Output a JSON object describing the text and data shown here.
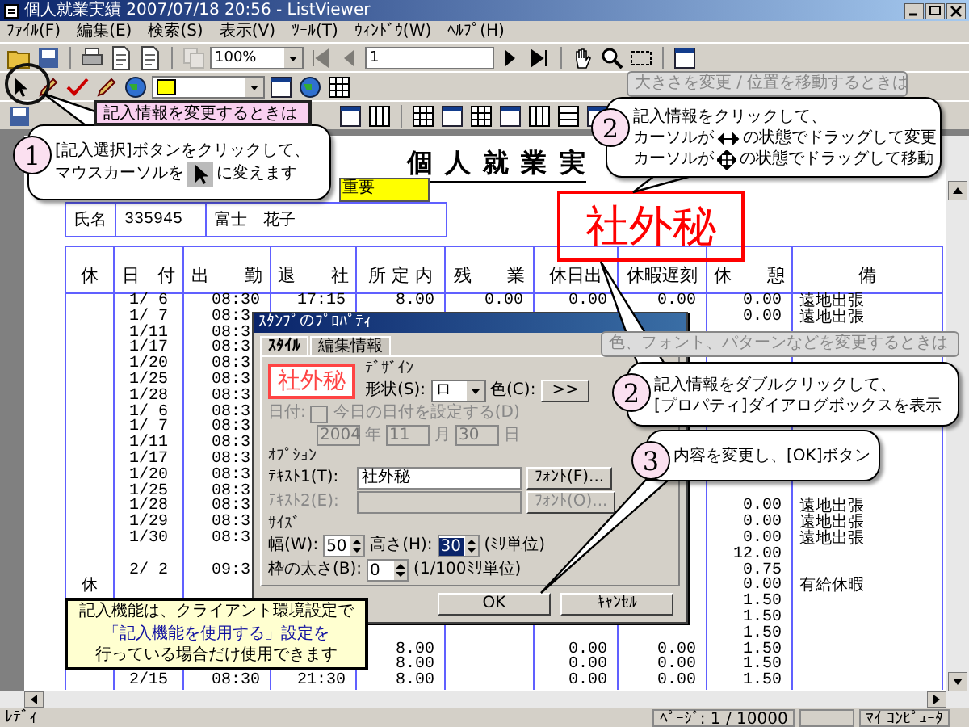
{
  "window": {
    "title": "個人就業実績 2007/07/18 20:56 - ListViewer"
  },
  "menu": [
    "ﾌｧｲﾙ(F)",
    "編集(E)",
    "検索(S)",
    "表示(V)",
    "ﾂｰﾙ(T)",
    "ｳｨﾝﾄﾞｳ(W)",
    "ﾍﾙﾌﾟ(H)"
  ],
  "toolbar": {
    "zoom": "100%",
    "page": "1"
  },
  "document": {
    "title": "個 人 就 業 実",
    "name_row": [
      "氏名",
      "335945",
      "富士　花子"
    ],
    "sticky_note": "重要",
    "stamp": "社外秘",
    "columns": [
      "休",
      "日　付",
      "出　　勤",
      "退　　社",
      "所 定 内",
      "残　　業",
      "休日出",
      "休暇遅刻",
      "休　　憩",
      "備"
    ],
    "rows": [
      {
        "date": "1/ 6",
        "start": "08:30",
        "end": "17:15",
        "scheduled": "8.00",
        "overtime": "0.00",
        "holiday_work": "0.00",
        "leave_late": "0.00",
        "break": "0.00",
        "note": "遠地出張"
      },
      {
        "date": "1/ 7",
        "start": "08:3",
        "break": "0.00",
        "note": "遠地出張"
      },
      {
        "date": "1/11",
        "start": "08:3"
      },
      {
        "date": "1/17",
        "start": "08:3"
      },
      {
        "date": "1/20",
        "start": "08:3"
      },
      {
        "date": "1/25",
        "start": "08:3"
      },
      {
        "date": "1/28",
        "start": "08:3"
      },
      {
        "date": "1/ 6",
        "start": "08:3"
      },
      {
        "date": "1/ 7",
        "start": "08:3"
      },
      {
        "date": "1/11",
        "start": "08:3"
      },
      {
        "date": "1/17",
        "start": "08:3"
      },
      {
        "date": "1/20",
        "start": "08:3"
      },
      {
        "date": "1/25",
        "start": "08:3"
      },
      {
        "date": "1/28",
        "start": "08:3",
        "break": "0.00",
        "note": "遠地出張"
      },
      {
        "date": "1/29",
        "start": "08:3",
        "break": "0.00",
        "note": "遠地出張"
      },
      {
        "date": "1/30",
        "start": "08:3",
        "break": "0.00",
        "note": "遠地出張"
      },
      {
        "break": "12.00"
      },
      {
        "date": "2/ 2",
        "start": "09:3",
        "break": "0.75"
      },
      {
        "off": "休",
        "break": "0.00",
        "note": "有給休暇"
      },
      {
        "break": "1.50"
      },
      {
        "break": "1.50"
      },
      {
        "break": "1.50"
      },
      {
        "scheduled": "8.00",
        "holiday_work": "0.00",
        "leave_late": "0.00",
        "break": "1.50"
      },
      {
        "scheduled": "8.00",
        "holiday_work": "0.00",
        "leave_late": "0.00",
        "break": "1.50"
      },
      {
        "date": "2/15",
        "start": "08:30",
        "end": "21:30",
        "scheduled": "8.00",
        "holiday_work": "0.00",
        "leave_late": "0.00",
        "break": "1.50"
      }
    ]
  },
  "dialog": {
    "title": "ｽﾀﾝﾌﾟのﾌﾟﾛﾊﾟﾃｨ",
    "tabs": [
      {
        "label": "ｽﾀｲﾙ",
        "selected": true
      },
      {
        "label": "編集情報",
        "selected": false
      }
    ],
    "preview": "社外秘",
    "design_label": "ﾃﾞｻﾞｲﾝ",
    "shape_label": "形状(S):",
    "shape_value": "ロ",
    "color_label": "色(C):",
    "color_button": ">>",
    "date_label": "日付:",
    "date_checkbox": {
      "label": "今日の日付を設定する(D)",
      "checked": false,
      "disabled": true
    },
    "date_fields": [
      {
        "value": "2004",
        "unit": "年"
      },
      {
        "value": "11",
        "unit": "月"
      },
      {
        "value": "30",
        "unit": "日"
      }
    ],
    "options_label": "ｵﾌﾟｼｮﾝ",
    "text_fields": [
      {
        "label": "ﾃｷｽﾄ1(T):",
        "value": "社外秘",
        "button": "ﾌｫﾝﾄ(F)...",
        "disabled": false
      },
      {
        "label": "ﾃｷｽﾄ2(E):",
        "button": "ﾌｫﾝﾄ(O)...",
        "disabled": true
      }
    ],
    "size_label": "ｻｲｽﾞ",
    "size_fields": [
      {
        "label": "幅(W):",
        "value": "50",
        "selected": false
      },
      {
        "label": "高さ(H):",
        "value": "30",
        "selected": true
      },
      {
        "label": "枠の太さ(B):",
        "value": "0",
        "selected": false
      }
    ],
    "size_units": [
      "(ﾐﾘ単位)",
      "(1/100ﾐﾘ単位)"
    ],
    "buttons": [
      "OK",
      "ｷｬﾝｾﾙ"
    ]
  },
  "callouts": [
    {
      "label": "記入情報を変更するときは",
      "number": "1",
      "lines": [
        {
          "parts": [
            "[記入選択]ボタンをクリックして、"
          ]
        },
        {
          "parts": [
            "マウスカーソルを",
            "に変えます"
          ]
        }
      ]
    },
    {
      "label": "大きさを変更 / 位置を移動するときは",
      "number": "2",
      "lines": [
        {
          "parts": [
            "記入情報をクリックして、"
          ]
        },
        {
          "parts": [
            "カーソルが",
            "の状態でドラッグして変更"
          ]
        },
        {
          "parts": [
            "カーソルが",
            "の状態でドラッグして移動"
          ]
        }
      ]
    },
    {
      "label": "色、フォント、パターンなどを変更するときは",
      "number": "2",
      "lines": [
        {
          "parts": [
            "記入情報をダブルクリックして、"
          ]
        },
        {
          "parts": [
            "[プロパティ]ダイアログボックスを表示"
          ]
        }
      ]
    },
    {
      "number": "3",
      "lines": [
        {
          "parts": [
            "内容を変更し、[OK]ボタン"
          ]
        }
      ]
    }
  ],
  "note": {
    "lines": [
      {
        "text": "記入機能は、クライアント環境設定で",
        "highlight": false
      },
      {
        "text": "「記入機能を使用する」設定を",
        "highlight": true
      },
      {
        "text": "行っている場合だけ使用できます",
        "highlight": false
      }
    ]
  },
  "status_bar": {
    "text": "ﾚﾃﾞｨ",
    "page": "ﾍﾟｰｼﾞ: 1 / 10000",
    "computer": "ﾏｲ ｺﾝﾋﾟｭｰﾀ"
  }
}
